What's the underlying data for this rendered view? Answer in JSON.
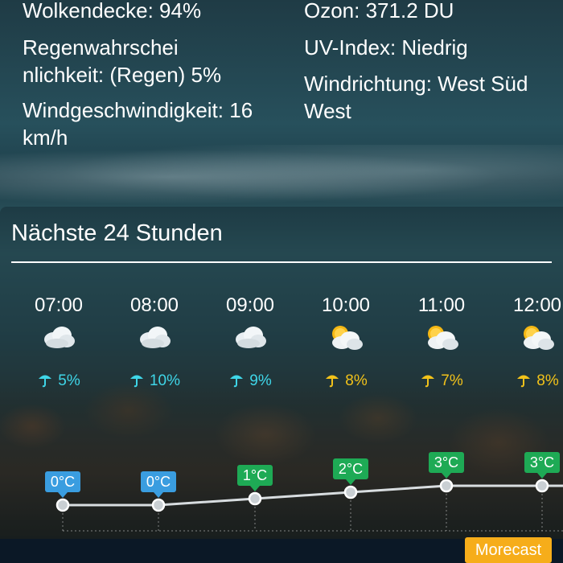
{
  "details": {
    "cloud_cover": "Wolkendecke: 94%",
    "ozone": "Ozon: 371.2 DU",
    "precip_prob_line1": "Regenwahrschei",
    "precip_prob_line2": "nlichkeit: (Regen) 5%",
    "uv_index": "UV-Index: Niedrig",
    "wind_speed_line1": "Windgeschwindigkeit: 16",
    "wind_speed_line2": "km/h",
    "wind_dir_line1": "Windrichtung: West Süd",
    "wind_dir_line2": "West"
  },
  "forecast": {
    "title": "Nächste 24 Stunden",
    "hours": [
      {
        "time": "07:00",
        "icon": "cloudy-icon",
        "precip": "5%",
        "precip_type": "snow",
        "temp": "0°C",
        "temp_value": 0,
        "temp_color": "#3a9de0"
      },
      {
        "time": "08:00",
        "icon": "cloudy-icon",
        "precip": "10%",
        "precip_type": "snow",
        "temp": "0°C",
        "temp_value": 0,
        "temp_color": "#3a9de0"
      },
      {
        "time": "09:00",
        "icon": "cloudy-icon",
        "precip": "9%",
        "precip_type": "snow",
        "temp": "1°C",
        "temp_value": 1,
        "temp_color": "#1eaa55"
      },
      {
        "time": "10:00",
        "icon": "partly-cloudy-icon",
        "precip": "8%",
        "precip_type": "rain",
        "temp": "2°C",
        "temp_value": 2,
        "temp_color": "#1eaa55"
      },
      {
        "time": "11:00",
        "icon": "partly-cloudy-icon",
        "precip": "7%",
        "precip_type": "rain",
        "temp": "3°C",
        "temp_value": 3,
        "temp_color": "#1eaa55"
      },
      {
        "time": "12:00",
        "icon": "partly-cloudy-icon",
        "precip": "8%",
        "precip_type": "rain",
        "temp": "3°C",
        "temp_value": 3,
        "temp_color": "#1eaa55"
      }
    ]
  },
  "footer": {
    "morecast_label": "Morecast"
  },
  "colors": {
    "snow_accent": "#3fd6e8",
    "rain_accent": "#f2c21a",
    "brand": "#f6ad1a"
  }
}
